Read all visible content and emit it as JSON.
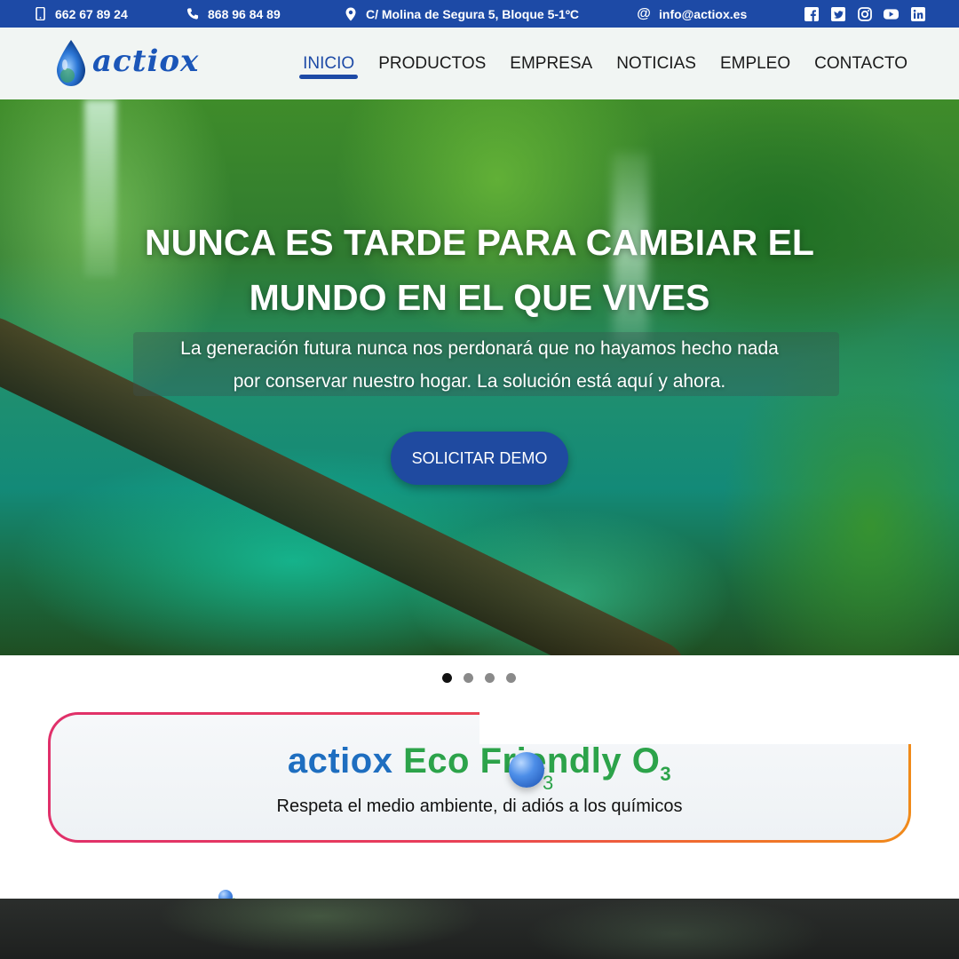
{
  "topbar": {
    "phone1": "662 67 89 24",
    "phone2": "868 96 84 89",
    "address": "C/ Molina de Segura 5, Bloque 5-1ºC",
    "email": "info@actiox.es",
    "social": [
      "facebook-icon",
      "twitter-icon",
      "instagram-icon",
      "youtube-icon",
      "linkedin-icon"
    ],
    "background_color": "#1d4aa6"
  },
  "logo": {
    "text": "actiox",
    "color": "#1b56b8"
  },
  "nav": {
    "items": [
      {
        "label": "INICIO",
        "active": true
      },
      {
        "label": "PRODUCTOS",
        "active": false
      },
      {
        "label": "EMPRESA",
        "active": false
      },
      {
        "label": "NOTICIAS",
        "active": false
      },
      {
        "label": "EMPLEO",
        "active": false
      },
      {
        "label": "CONTACTO",
        "active": false
      }
    ],
    "active_color": "#1d4aa6"
  },
  "hero": {
    "title_line1": "NUNCA ES TARDE PARA CAMBIAR EL",
    "title_line2": "MUNDO EN EL QUE VIVES",
    "text_line1": "La generación futura nunca nos perdonará que no hayamos hecho nada",
    "text_line2": "por conservar nuestro hogar. La solución está aquí y ahora.",
    "button_label": "SOLICITAR DEMO",
    "button_color": "#1f4aa0"
  },
  "slider": {
    "slide_count": 4,
    "active_index": 0
  },
  "eco": {
    "brand": "actiox",
    "rest": "Eco Friendly O",
    "subscript": "3",
    "tagline": "Respeta el medio ambiente, di adiós a los químicos",
    "brand_color": "#1e6ec0",
    "accent_color": "#2ca34a"
  }
}
